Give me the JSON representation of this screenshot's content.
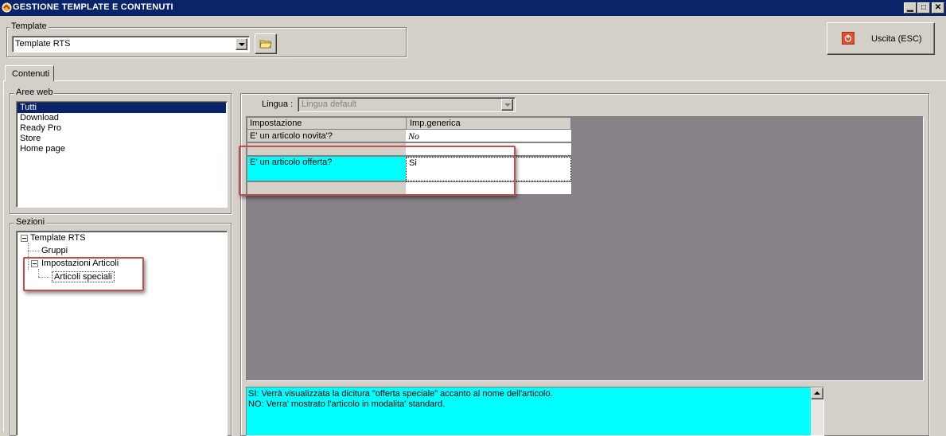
{
  "window": {
    "title": "GESTIONE TEMPLATE E CONTENUTI"
  },
  "template_group": {
    "label": "Template",
    "combo_value": "Template RTS"
  },
  "exit_button": {
    "label": "Uscita (ESC)"
  },
  "tabs": [
    {
      "label": "Contenuti"
    }
  ],
  "aree_web": {
    "label": "Aree web",
    "items": [
      "Tutti",
      "Download",
      "Ready Pro",
      "Store",
      "Home page"
    ],
    "selected": "Tutti"
  },
  "sezioni": {
    "label": "Sezioni",
    "tree": {
      "root": "Template RTS",
      "child1": "Gruppi",
      "child2": "Impostazioni Articoli",
      "grandchild": "Articoli speciali"
    }
  },
  "lingua": {
    "label": "Lingua :",
    "value": "Lingua default"
  },
  "grid": {
    "headers": [
      "Impostazione",
      "Imp.generica"
    ],
    "rows": [
      {
        "setting": "E' un articolo novita'?",
        "value": "No"
      },
      {
        "setting": "",
        "value": ""
      },
      {
        "setting": "E' un articolo offerta?",
        "value": "Si"
      },
      {
        "setting": "",
        "value": ""
      }
    ]
  },
  "description": {
    "lines": [
      "SI: Verrà visualizzata la dicitura \"offerta speciale\" accanto al nome dell'articolo.",
      "NO: Verra' mostrato l'articolo in modalita' standard."
    ]
  },
  "colors": {
    "title_bar": "#0a246a",
    "highlight_cyan": "#00ffff",
    "grid_background": "#868288",
    "annotation_red": "#c0504d"
  }
}
